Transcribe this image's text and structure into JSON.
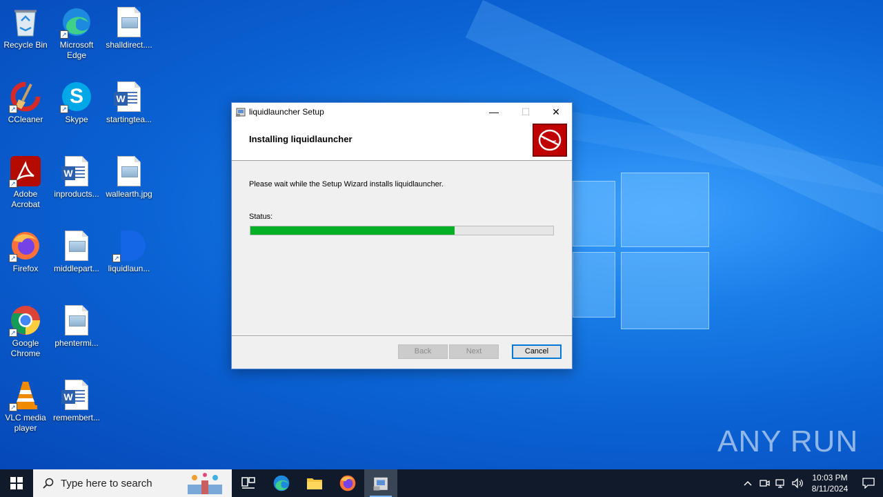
{
  "desktop": {
    "icons": [
      {
        "label": "Recycle Bin"
      },
      {
        "label": "Microsoft Edge"
      },
      {
        "label": "shalldirect...."
      },
      {
        "label": "CCleaner"
      },
      {
        "label": "Skype"
      },
      {
        "label": "startingtea..."
      },
      {
        "label": "Adobe Acrobat"
      },
      {
        "label": "inproducts..."
      },
      {
        "label": "wallearth.jpg"
      },
      {
        "label": "Firefox"
      },
      {
        "label": "middlepart..."
      },
      {
        "label": "liquidlaun..."
      },
      {
        "label": "Google Chrome"
      },
      {
        "label": "phentermi..."
      },
      {
        "label": "VLC media player"
      },
      {
        "label": "remembert..."
      }
    ]
  },
  "dialog": {
    "title": "liquidlauncher Setup",
    "heading": "Installing liquidlauncher",
    "message": "Please wait while the Setup Wizard installs liquidlauncher.",
    "status_label": "Status:",
    "progress_fraction": 0.675,
    "buttons": {
      "back": "Back",
      "next": "Next",
      "cancel": "Cancel"
    },
    "title_controls": {
      "minimize": "—",
      "maximize": "☐",
      "close": "✕"
    }
  },
  "watermark": {
    "text": "ANY RUN"
  },
  "taskbar": {
    "search_placeholder": "Type here to search",
    "apps": [
      "task-view",
      "edge",
      "file-explorer",
      "firefox",
      "installer"
    ],
    "clock": {
      "time": "10:03 PM",
      "date": "8/11/2024"
    }
  },
  "colors": {
    "progress": "#06b025",
    "accent": "#0078d7",
    "banner": "#c00000"
  }
}
